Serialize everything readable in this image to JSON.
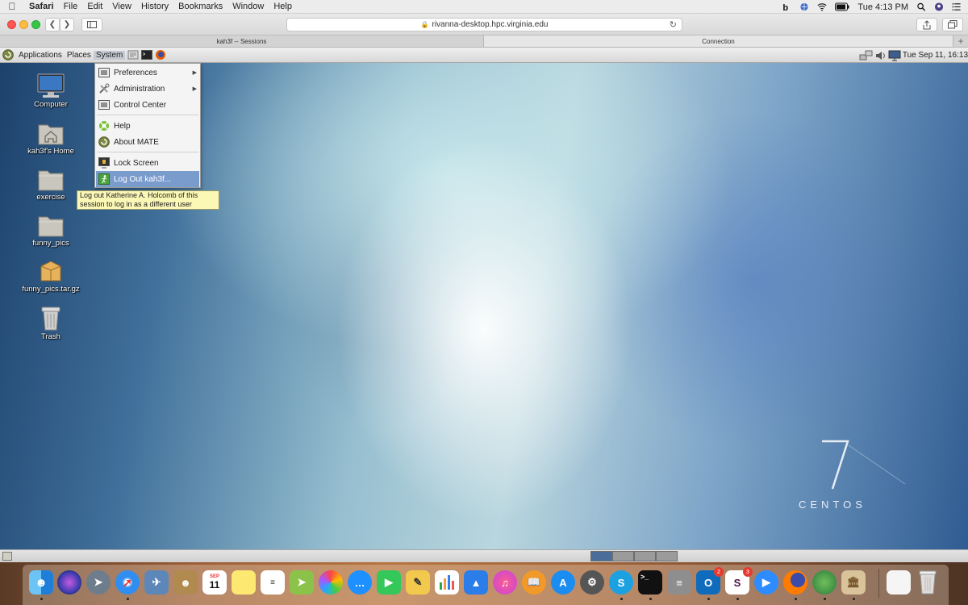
{
  "mac_menubar": {
    "app_name": "Safari",
    "menus": [
      "File",
      "Edit",
      "View",
      "History",
      "Bookmarks",
      "Window",
      "Help"
    ],
    "clock": "Tue 4:13 PM"
  },
  "safari": {
    "url": "rivanna-desktop.hpc.virginia.edu",
    "tabs": [
      {
        "label": "kah3f -- Sessions"
      },
      {
        "label": "Connection"
      }
    ],
    "new_tab_label": "+"
  },
  "mate_panel": {
    "menus": [
      "Applications",
      "Places",
      "System"
    ],
    "datetime": "Tue Sep 11, 16:13"
  },
  "system_menu": {
    "items": [
      {
        "label": "Preferences",
        "submenu": true
      },
      {
        "label": "Administration",
        "submenu": true
      },
      {
        "label": "Control Center",
        "submenu": false
      },
      {
        "label": "Help",
        "submenu": false
      },
      {
        "label": "About MATE",
        "submenu": false
      },
      {
        "label": "Lock Screen",
        "submenu": false
      },
      {
        "label": "Log Out kah3f...",
        "submenu": false,
        "highlighted": true
      }
    ],
    "tooltip_lines": [
      "Log out Katherine A. Holcomb of this",
      "session to log in as a different user"
    ]
  },
  "desktop_icons": [
    {
      "label": "Computer",
      "icon": "computer-icon"
    },
    {
      "label": "kah3f's Home",
      "icon": "home-folder-icon"
    },
    {
      "label": "exercise",
      "icon": "folder-icon"
    },
    {
      "label": "funny_pics",
      "icon": "folder-icon"
    },
    {
      "label": "funny_pics.tar.gz",
      "icon": "archive-icon"
    },
    {
      "label": "Trash",
      "icon": "trash-icon"
    }
  ],
  "wallpaper": {
    "digit": "7",
    "word": "CENTOS"
  },
  "workspaces": {
    "count": 4,
    "active_index": 0
  },
  "dock": {
    "calendar_month": "SEP",
    "calendar_day": "11",
    "outlook_badge": "2",
    "slack_badge": "3"
  },
  "colors": {
    "menu_highlight": "#7a9ccd",
    "tooltip_bg": "#fbf7b5"
  }
}
